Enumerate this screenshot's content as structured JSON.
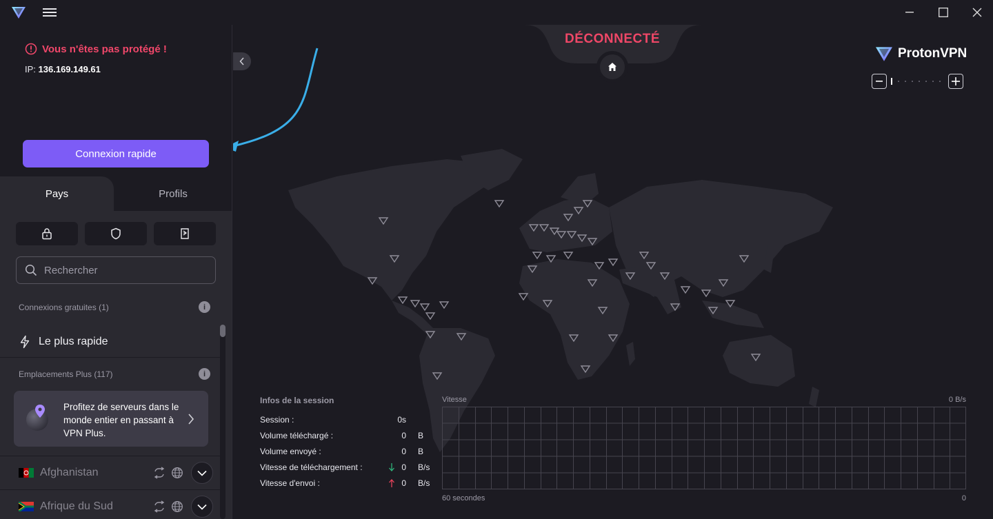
{
  "header": {
    "menu_icon": "hamburger-icon"
  },
  "status": {
    "warning": "Vous n'êtes pas protégé !",
    "ip_label": "IP:",
    "ip_value": "136.169.149.61",
    "connection_state": "DÉCONNECTÉ"
  },
  "quick_connect": {
    "label": "Connexion rapide"
  },
  "tabs": [
    {
      "label": "Pays"
    },
    {
      "label": "Profils"
    }
  ],
  "filters": [
    {
      "icon": "lock-icon"
    },
    {
      "icon": "shield-icon"
    },
    {
      "icon": "p2p-icon"
    }
  ],
  "search": {
    "placeholder": "Rechercher"
  },
  "free_section": {
    "label": "Connexions gratuites (1)",
    "fastest": "Le plus rapide"
  },
  "plus_section": {
    "label": "Emplacements Plus (117)",
    "card_text": "Profitez de serveurs dans le monde entier en passant à VPN Plus."
  },
  "countries": [
    {
      "name": "Afghanistan"
    },
    {
      "name": "Afrique du Sud"
    }
  ],
  "brand": {
    "name": "ProtonVPN"
  },
  "session": {
    "title": "Infos de la session",
    "rows": [
      {
        "label": "Session :",
        "value": "0s",
        "unit": ""
      },
      {
        "label": "Volume téléchargé :",
        "value": "0",
        "unit": "B"
      },
      {
        "label": "Volume envoyé :",
        "value": "0",
        "unit": "B"
      },
      {
        "label": "Vitesse de téléchargement :",
        "value": "0",
        "unit": "B/s"
      },
      {
        "label": "Vitesse d'envoi :",
        "value": "0",
        "unit": "B/s"
      }
    ]
  },
  "graph": {
    "title": "Vitesse",
    "current": "0  B/s",
    "x_start": "60 secondes",
    "x_end": "0"
  },
  "colors": {
    "accent": "#7d5cf6",
    "danger": "#ef4767",
    "download": "#2fb37a",
    "upload": "#e8435b"
  }
}
